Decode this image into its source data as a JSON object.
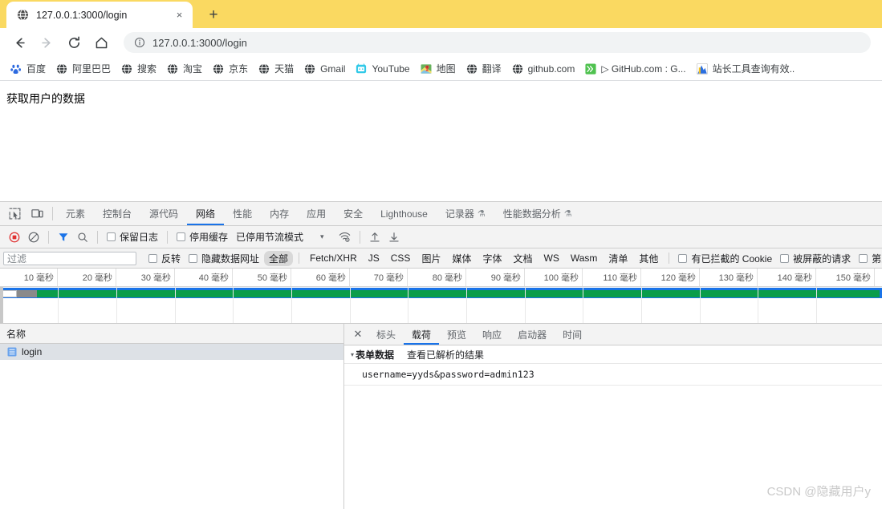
{
  "browser": {
    "tab": {
      "title": "127.0.0.1:3000/login",
      "favicon": "globe-icon",
      "close": "×"
    },
    "newtab_label": "+",
    "nav": {
      "back": "←",
      "forward": "→",
      "reload": "⟳",
      "home": "⌂"
    },
    "omnibox": {
      "url": "127.0.0.1:3000/login",
      "info_icon": "info-circle-icon"
    },
    "bookmarks": [
      {
        "label": "百度",
        "icon": "baidu-paw-icon"
      },
      {
        "label": "阿里巴巴",
        "icon": "globe-icon"
      },
      {
        "label": "搜索",
        "icon": "globe-icon"
      },
      {
        "label": "淘宝",
        "icon": "globe-icon"
      },
      {
        "label": "京东",
        "icon": "globe-icon"
      },
      {
        "label": "天猫",
        "icon": "globe-icon"
      },
      {
        "label": "Gmail",
        "icon": "globe-icon"
      },
      {
        "label": "YouTube",
        "icon": "youtube-icon"
      },
      {
        "label": "地图",
        "icon": "maps-icon"
      },
      {
        "label": "翻译",
        "icon": "globe-icon"
      },
      {
        "label": "github.com",
        "icon": "globe-icon"
      },
      {
        "label": "▷ GitHub.com : G...",
        "icon": "chevrons-right-icon"
      },
      {
        "label": "站长工具查询有效..",
        "icon": "chart-icon"
      }
    ]
  },
  "page": {
    "text": "获取用户的数据"
  },
  "devtools": {
    "left_icons": [
      {
        "name": "inspect-element-icon"
      },
      {
        "name": "device-toolbar-icon"
      }
    ],
    "tabs": [
      {
        "label": "元素",
        "active": false
      },
      {
        "label": "控制台",
        "active": false
      },
      {
        "label": "源代码",
        "active": false
      },
      {
        "label": "网络",
        "active": true
      },
      {
        "label": "性能",
        "active": false
      },
      {
        "label": "内存",
        "active": false
      },
      {
        "label": "应用",
        "active": false
      },
      {
        "label": "安全",
        "active": false
      },
      {
        "label": "Lighthouse",
        "active": false
      },
      {
        "label": "记录器",
        "active": false,
        "beaker": "⚗"
      },
      {
        "label": "性能数据分析",
        "active": false,
        "beaker": "⚗"
      }
    ],
    "toolbar": {
      "record_icon": "record-stop-icon",
      "clear_icon": "clear-icon",
      "filter_icon": "funnel-icon",
      "search_icon": "search-icon",
      "preserve_log": "保留日志",
      "disable_cache": "停用缓存",
      "throttling": "已停用节流模式",
      "throttle_caret": "▾",
      "wifi_icon": "network-conditions-icon",
      "import_icon": "import-har-icon",
      "export_icon": "export-har-icon"
    },
    "filterbar": {
      "placeholder": "过滤",
      "invert": "反转",
      "hide_data_urls": "隐藏数据网址",
      "types": [
        "全部",
        "Fetch/XHR",
        "JS",
        "CSS",
        "图片",
        "媒体",
        "字体",
        "文档",
        "WS",
        "Wasm",
        "清单",
        "其他"
      ],
      "active_type": "全部",
      "blocked_cookies": "有已拦截的 Cookie",
      "blocked_requests": "被屏蔽的请求",
      "third_party": "第三方请求"
    },
    "timeline": {
      "ticks": [
        "10 毫秒",
        "20 毫秒",
        "30 毫秒",
        "40 毫秒",
        "50 毫秒",
        "60 毫秒",
        "70 毫秒",
        "80 毫秒",
        "90 毫秒",
        "100 毫秒",
        "110 毫秒",
        "120 毫秒",
        "130 毫秒",
        "140 毫秒",
        "150 毫秒"
      ],
      "band_color": "#1a73e8",
      "bar_color": "#0a9d4a"
    },
    "requests": {
      "column_header": "名称",
      "rows": [
        {
          "name": "login",
          "icon": "document-icon",
          "selected": true
        }
      ]
    },
    "detail": {
      "close": "✕",
      "tabs": [
        {
          "label": "标头",
          "active": false
        },
        {
          "label": "载荷",
          "active": true
        },
        {
          "label": "预览",
          "active": false
        },
        {
          "label": "响应",
          "active": false
        },
        {
          "label": "启动器",
          "active": false
        },
        {
          "label": "时间",
          "active": false
        }
      ],
      "section_title": "表单数据",
      "section_link": "查看已解析的结果",
      "body_text": "username=yyds&password=admin123"
    }
  },
  "watermark": "CSDN @隐藏用户y"
}
